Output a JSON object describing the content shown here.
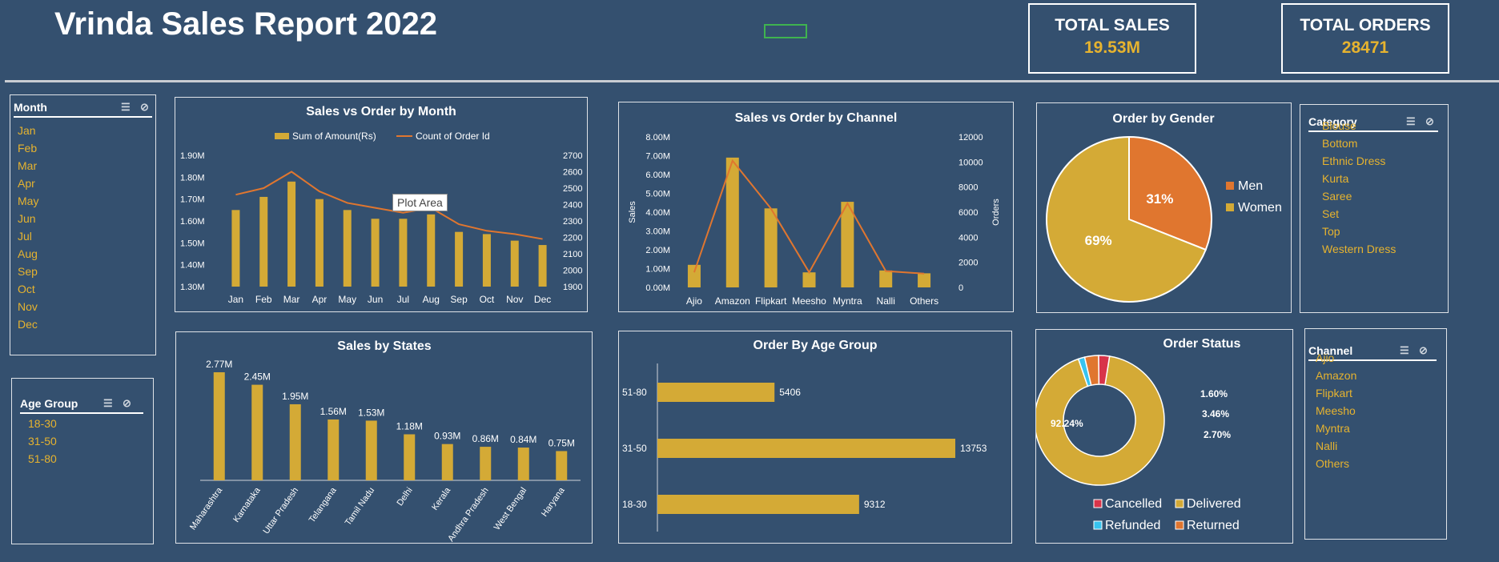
{
  "header": {
    "title": "Vrinda Sales Report 2022"
  },
  "kpi": {
    "sales": {
      "label": "TOTAL SALES",
      "value": "19.53M"
    },
    "orders": {
      "label": "TOTAL ORDERS",
      "value": "28471"
    }
  },
  "colors": {
    "gold": "#d4aa36",
    "orange": "#e0762f",
    "bg": "#34506f",
    "red": "#d8344a",
    "cyan": "#37c3ef",
    "gold_light": "#e6b32f"
  },
  "tooltip": "Plot Area",
  "slicers": {
    "month": {
      "title": "Month",
      "items": [
        "Jan",
        "Feb",
        "Mar",
        "Apr",
        "May",
        "Jun",
        "Jul",
        "Aug",
        "Sep",
        "Oct",
        "Nov",
        "Dec"
      ]
    },
    "age": {
      "title": "Age Group",
      "items": [
        "18-30",
        "31-50",
        "51-80"
      ]
    },
    "category": {
      "title": "Category",
      "items": [
        "Blouse",
        "Bottom",
        "Ethnic Dress",
        "Kurta",
        "Saree",
        "Set",
        "Top",
        "Western Dress"
      ]
    },
    "channel": {
      "title": "Channel",
      "items": [
        "Ajio",
        "Amazon",
        "Flipkart",
        "Meesho",
        "Myntra",
        "Nalli",
        "Others"
      ]
    }
  },
  "chart_data": [
    {
      "type": "bar",
      "title": "Sales vs Order by Month",
      "categories": [
        "Jan",
        "Feb",
        "Mar",
        "Apr",
        "May",
        "Jun",
        "Jul",
        "Aug",
        "Sep",
        "Oct",
        "Nov",
        "Dec"
      ],
      "series": [
        {
          "name": "Sum of Amount(Rs)",
          "kind": "bar",
          "axis": "left",
          "values": [
            1.65,
            1.71,
            1.78,
            1.7,
            1.65,
            1.61,
            1.61,
            1.63,
            1.55,
            1.54,
            1.51,
            1.49
          ]
        },
        {
          "name": "Count of Order Id",
          "kind": "line",
          "axis": "right",
          "values": [
            2460,
            2500,
            2600,
            2480,
            2410,
            2380,
            2350,
            2380,
            2280,
            2240,
            2220,
            2190
          ]
        }
      ],
      "y_left": {
        "ticks": [
          "1.30M",
          "1.40M",
          "1.50M",
          "1.60M",
          "1.70M",
          "1.80M",
          "1.90M"
        ],
        "range": [
          1.3,
          1.9
        ]
      },
      "y_right": {
        "ticks": [
          "1900",
          "2000",
          "2100",
          "2200",
          "2300",
          "2400",
          "2500",
          "2600",
          "2700"
        ],
        "range": [
          1900,
          2700
        ]
      },
      "legend": "top"
    },
    {
      "type": "bar",
      "title": "Sales vs Order by Channel",
      "categories": [
        "Ajio",
        "Amazon",
        "Flipkart",
        "Meesho",
        "Myntra",
        "Nalli",
        "Others"
      ],
      "ylabel": "Sales",
      "y2label": "Orders",
      "series": [
        {
          "name": "Sales",
          "kind": "bar",
          "axis": "left",
          "values": [
            1.2,
            6.9,
            4.2,
            0.8,
            4.55,
            0.9,
            0.75
          ]
        },
        {
          "name": "Orders",
          "kind": "line",
          "axis": "right",
          "values": [
            1200,
            10100,
            6300,
            1200,
            6700,
            1300,
            1100
          ]
        }
      ],
      "y_left": {
        "ticks": [
          "0.00M",
          "1.00M",
          "2.00M",
          "3.00M",
          "4.00M",
          "5.00M",
          "6.00M",
          "7.00M",
          "8.00M"
        ],
        "range": [
          0,
          8
        ]
      },
      "y_right": {
        "ticks": [
          "0",
          "2000",
          "4000",
          "6000",
          "8000",
          "10000",
          "12000"
        ],
        "range": [
          0,
          12000
        ]
      }
    },
    {
      "type": "pie",
      "title": "Order by Gender",
      "slices": [
        {
          "name": "Men",
          "value": 31,
          "label": "31%"
        },
        {
          "name": "Women",
          "value": 69,
          "label": "69%"
        }
      ],
      "legend": "right"
    },
    {
      "type": "bar",
      "title": "Sales by States",
      "categories": [
        "Maharashtra",
        "Karnataka",
        "Uttar Pradesh",
        "Telangana",
        "Tamil Nadu",
        "Delhi",
        "Kerala",
        "Andhra Pradesh",
        "West Bengal",
        "Haryana"
      ],
      "values": [
        2.77,
        2.45,
        1.95,
        1.56,
        1.53,
        1.18,
        0.93,
        0.86,
        0.84,
        0.75
      ],
      "labels": [
        "2.77M",
        "2.45M",
        "1.95M",
        "1.56M",
        "1.53M",
        "1.18M",
        "0.93M",
        "0.86M",
        "0.84M",
        "0.75M"
      ]
    },
    {
      "type": "bar",
      "orientation": "horizontal",
      "title": "Order By Age Group",
      "categories": [
        "51-80",
        "31-50",
        "18-30"
      ],
      "values": [
        5406,
        13753,
        9312
      ],
      "labels": [
        "5406",
        "13753",
        "9312"
      ]
    },
    {
      "type": "pie",
      "subtype": "donut",
      "title": "Order Status",
      "slices": [
        {
          "name": "Delivered",
          "value": 92.24,
          "label": "92.24%"
        },
        {
          "name": "Refunded",
          "value": 1.6,
          "label": "1.60%"
        },
        {
          "name": "Returned",
          "value": 3.46,
          "label": "3.46%"
        },
        {
          "name": "Cancelled",
          "value": 2.7,
          "label": "2.70%"
        }
      ],
      "legend": [
        "Cancelled",
        "Delivered",
        "Refunded",
        "Returned"
      ]
    }
  ]
}
